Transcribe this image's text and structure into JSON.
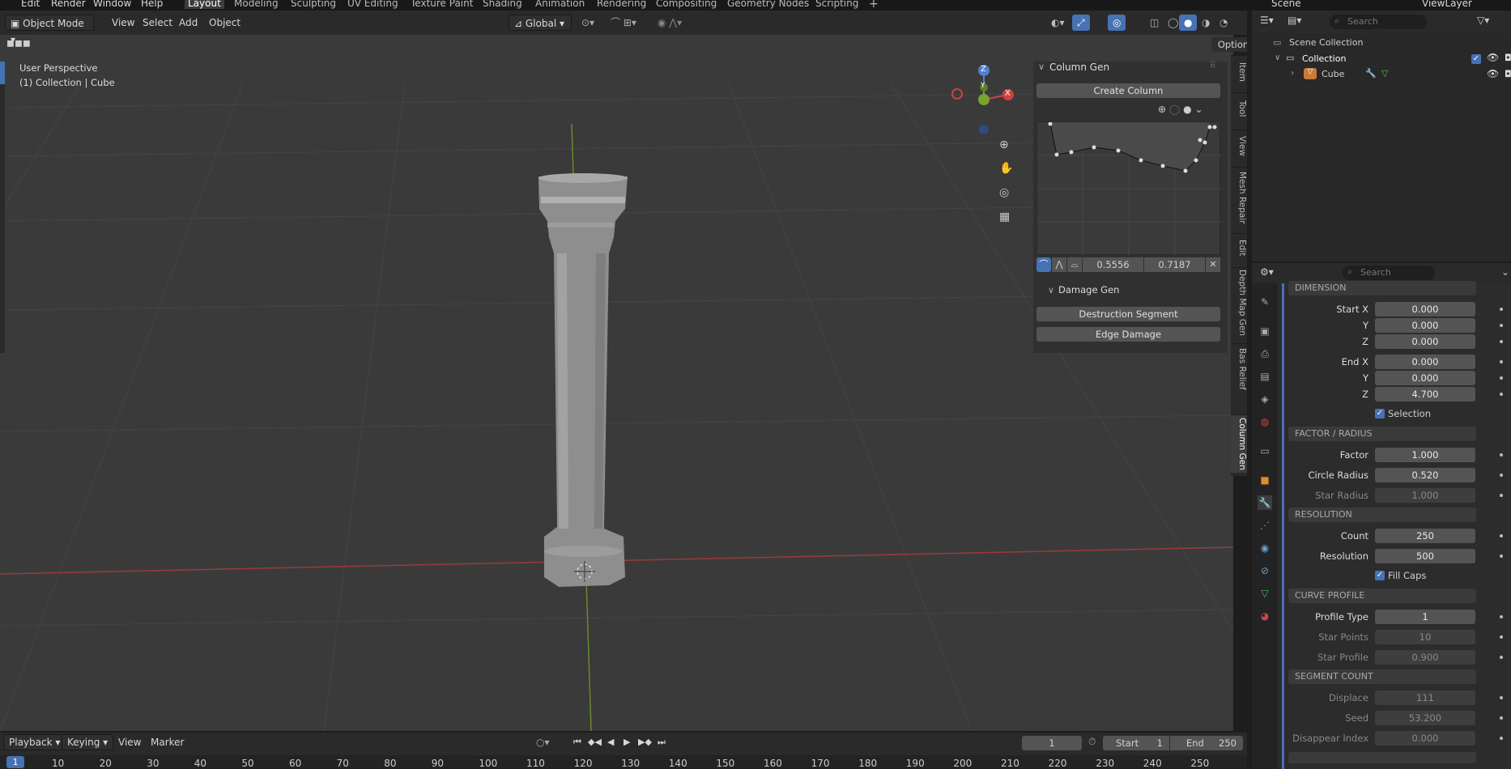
{
  "top_menu": [
    "Edit",
    "Render",
    "Window",
    "Help"
  ],
  "workspaces": [
    "Layout",
    "Modeling",
    "Sculpting",
    "UV Editing",
    "Texture Paint",
    "Shading",
    "Animation",
    "Rendering",
    "Compositing",
    "Geometry Nodes",
    "Scripting"
  ],
  "scene_name": "Scene",
  "view_layer": "ViewLayer",
  "header": {
    "mode": "Object Mode",
    "menus": [
      "View",
      "Select",
      "Add",
      "Object"
    ],
    "orientation": "Global",
    "options": "Options"
  },
  "viewport": {
    "view_name": "User Perspective",
    "collection_info": "(1) Collection | Cube",
    "gizmo": {
      "z": "Z",
      "y": "Y",
      "x": "X"
    }
  },
  "npanel": {
    "title": "Column Gen",
    "create_button": "Create Column",
    "curve_x": "0.5556",
    "curve_y": "0.7187",
    "damage_title": "Damage Gen",
    "damage_buttons": [
      "Destruction Segment",
      "Edge Damage"
    ],
    "tabs": [
      "Item",
      "Tool",
      "View",
      "Mesh Repair",
      "Edit",
      "Depth Map Gen",
      "Bas Relief",
      "Column Gen"
    ]
  },
  "outliner": {
    "search_placeholder": "Search",
    "scene_collection": "Scene Collection",
    "collection": "Collection",
    "cube": "Cube"
  },
  "properties": {
    "search_placeholder": "Search",
    "dimension": {
      "header": "DIMENSION",
      "rows": [
        {
          "label": "Start X",
          "value": "0.000"
        },
        {
          "label": "Y",
          "value": "0.000"
        },
        {
          "label": "Z",
          "value": "0.000"
        },
        {
          "label": "End X",
          "value": "0.000"
        },
        {
          "label": "Y",
          "value": "0.000"
        },
        {
          "label": "Z",
          "value": "4.700"
        }
      ],
      "selection_label": "Selection"
    },
    "factor_radius": {
      "header": "FACTOR / RADIUS",
      "rows": [
        {
          "label": "Factor",
          "value": "1.000"
        },
        {
          "label": "Circle Radius",
          "value": "0.520"
        },
        {
          "label": "Star Radius",
          "value": "1.000"
        }
      ]
    },
    "resolution": {
      "header": "RESOLUTION",
      "rows": [
        {
          "label": "Count",
          "value": "250"
        },
        {
          "label": "Resolution",
          "value": "500"
        }
      ],
      "fill_caps_label": "Fill Caps"
    },
    "curve_profile": {
      "header": "CURVE PROFILE",
      "rows": [
        {
          "label": "Profile Type",
          "value": "1"
        },
        {
          "label": "Star Points",
          "value": "10"
        },
        {
          "label": "Star Profile",
          "value": "0.900"
        }
      ]
    },
    "segment_count": {
      "header": "SEGMENT COUNT",
      "rows": [
        {
          "label": "Displace",
          "value": "111"
        },
        {
          "label": "Seed",
          "value": "53.200"
        },
        {
          "label": "Disappear Index",
          "value": "0.000"
        }
      ]
    }
  },
  "timeline": {
    "menus": [
      "Playback",
      "Keying",
      "View",
      "Marker"
    ],
    "current_frame": "1",
    "start_label": "Start",
    "start_value": "1",
    "end_label": "End",
    "end_value": "250",
    "ruler": [
      "1",
      "10",
      "20",
      "30",
      "40",
      "50",
      "60",
      "70",
      "80",
      "90",
      "100",
      "110",
      "120",
      "130",
      "140",
      "150",
      "160",
      "170",
      "180",
      "190",
      "200",
      "210",
      "220",
      "230",
      "240",
      "250"
    ]
  }
}
